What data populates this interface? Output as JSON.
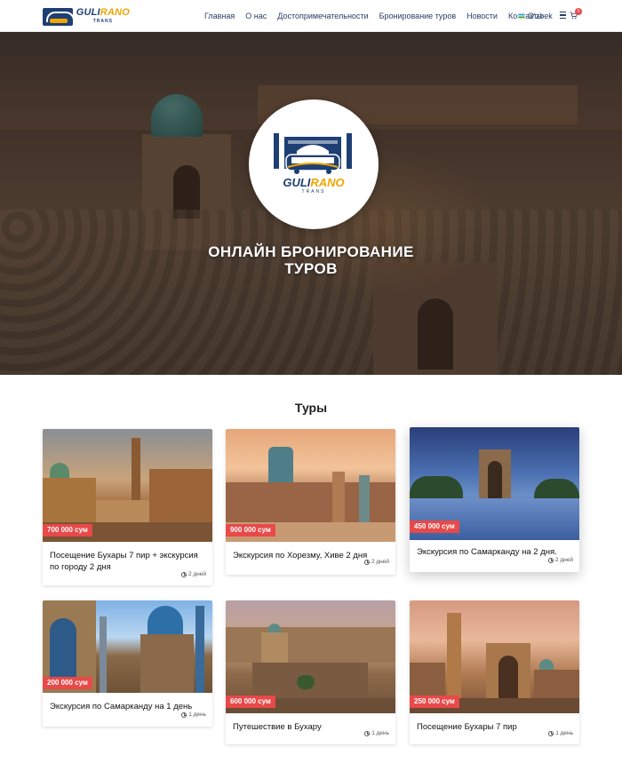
{
  "header": {
    "logo": {
      "brand_main": "GULI",
      "brand_accent": "RANO",
      "brand_sub": "TRANS"
    },
    "nav": [
      {
        "label": "Главная"
      },
      {
        "label": "О нас"
      },
      {
        "label": "Достопримечательности"
      },
      {
        "label": "Бронирование туров"
      },
      {
        "label": "Новости"
      },
      {
        "label": "Контакты"
      }
    ],
    "language": "O'zbek",
    "cart_count": "0",
    "icons": [
      "menu-icon",
      "cart-icon",
      "uzbekistan-flag-icon"
    ]
  },
  "hero": {
    "logo": {
      "brand_main": "GULI",
      "brand_accent": "RANO",
      "brand_sub": "TRANS"
    },
    "title_line1": "ОНЛАЙН БРОНИРОВАНИЕ",
    "title_line2": "ТУРОВ"
  },
  "tours": {
    "title": "Туры",
    "items": [
      {
        "price": "700 000 сум",
        "name": "Посещение Бухары 7 пир + экскурсия по городу 2 дня",
        "duration": "2 дней"
      },
      {
        "price": "900 000 сум",
        "name": "Экскурсия по Хорезму, Хиве 2 дня",
        "duration": "2 дней"
      },
      {
        "price": "450 000 сум",
        "name": "Экскурсия по Самарканду на 2 дня.",
        "duration": "2 дней"
      },
      {
        "price": "200 000 сум",
        "name": "Экскурсия по Самарканду на 1 день",
        "duration": "1 день"
      },
      {
        "price": "600 000 сум",
        "name": "Путешествие в Бухару",
        "duration": "1 день"
      },
      {
        "price": "250 000 сум",
        "name": "Посещение Бухары 7 пир",
        "duration": "1 день"
      }
    ]
  },
  "colors": {
    "primary": "#1e3f74",
    "accent": "#f0a500",
    "price_badge": "#e84949"
  }
}
